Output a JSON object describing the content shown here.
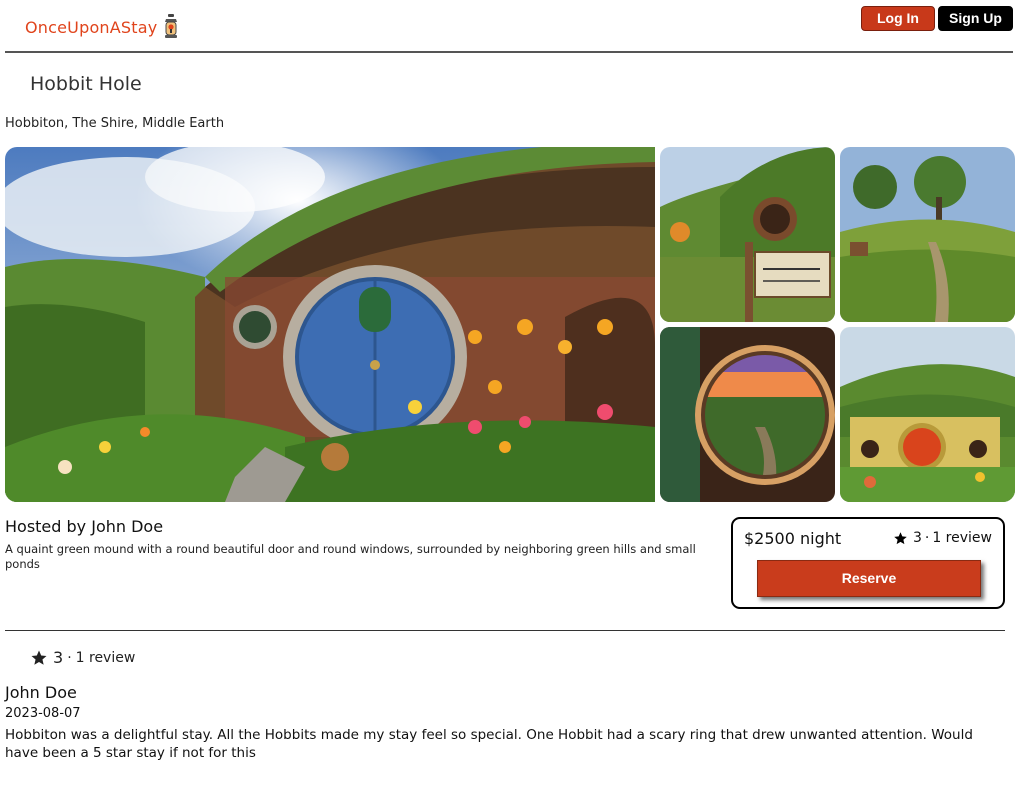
{
  "header": {
    "logo_text": "OnceUponAStay",
    "logo_icon": "lantern-icon",
    "login_label": "Log In",
    "signup_label": "Sign Up"
  },
  "listing": {
    "title": "Hobbit Hole",
    "location": "Hobbiton, The Shire, Middle Earth",
    "host_line": "Hosted by John Doe",
    "description": "A quaint green mound with a round beautiful door and round windows, surrounded by neighboring green hills and small ponds"
  },
  "booking": {
    "price": "$2500 night",
    "rating": "3",
    "separator": "·",
    "review_count": "1 review",
    "reserve_label": "Reserve"
  },
  "reviews": {
    "summary_rating": "3",
    "summary_separator": "·",
    "summary_count": "1 review",
    "items": [
      {
        "author": "John Doe",
        "date": "2023-08-07",
        "text": "Hobbiton was a delightful stay. All the Hobbits made my stay feel so special. One Hobbit had a scary ring that drew unwanted attention. Would have been a 5 star stay if not for this"
      }
    ]
  },
  "colors": {
    "brand": "#e0441c",
    "reserve": "#c93c1c",
    "login": "#c8391a"
  }
}
